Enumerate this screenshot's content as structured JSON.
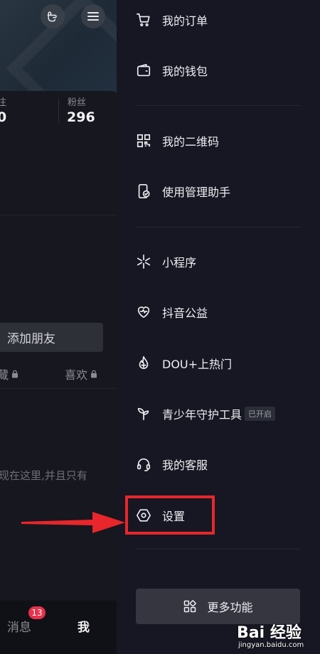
{
  "profile": {
    "stats": [
      {
        "label": "注",
        "value": "0"
      },
      {
        "label": "粉丝",
        "value": "296"
      }
    ],
    "add_friend_label": "添加朋友",
    "tabs": [
      {
        "label": "藏",
        "locked": true
      },
      {
        "label": "喜欢",
        "locked": true
      }
    ],
    "hint_text": "现在这里,并且只有"
  },
  "bottom_nav": {
    "messages_label": "消息",
    "messages_badge": "13",
    "me_label": "我"
  },
  "drawer": {
    "items": [
      {
        "label": "我的订单",
        "icon": "cart-icon"
      },
      {
        "label": "我的钱包",
        "icon": "wallet-icon"
      },
      {
        "label": "我的二维码",
        "icon": "qrcode-icon"
      },
      {
        "label": "使用管理助手",
        "icon": "phone-check-icon"
      },
      {
        "label": "小程序",
        "icon": "mini-program-icon"
      },
      {
        "label": "抖音公益",
        "icon": "heart-charity-icon"
      },
      {
        "label": "DOU+上热门",
        "icon": "flame-plus-icon"
      },
      {
        "label": "青少年守护工具",
        "icon": "sprout-icon",
        "badge": "已开启"
      },
      {
        "label": "我的客服",
        "icon": "headset-icon"
      },
      {
        "label": "设置",
        "icon": "settings-hexagon-icon"
      }
    ],
    "more_label": "更多功能"
  },
  "annotation": {
    "highlight_color": "#e8262b"
  },
  "watermark": {
    "logo": "Bai 经验",
    "url": "jingyan.baidu.com"
  }
}
